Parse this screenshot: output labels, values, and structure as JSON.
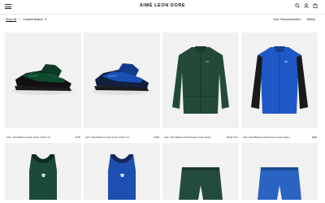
{
  "header": {
    "brand": "AIMÉ LEON DORE"
  },
  "filters": {
    "shop_all": "Shop All",
    "collection": "Curated Basics",
    "sort": "Sort: Recommended",
    "refine": "Refine"
  },
  "products": [
    {
      "name": "ALD / New Balance Fresh Foam X More v5",
      "price": "$175",
      "colors": {
        "main": "#0f4a2f",
        "accent": "#111111"
      }
    },
    {
      "name": "ALD / New Balance Fresh Foam X More v5",
      "price": "$185",
      "colors": {
        "main": "#1a4fb5",
        "accent": "#121f3d"
      }
    },
    {
      "name": "ALD / New Balance Performance Track Jacket",
      "price": "SOLD OUT",
      "colors": {
        "main": "#234a38",
        "accent": "#1c3a2c"
      }
    },
    {
      "name": "ALD / New Balance Performance Track Jacket",
      "price": "$385",
      "colors": {
        "main": "#1f58c7",
        "accent": "#1a1a1a"
      }
    },
    {
      "name": "",
      "price": "",
      "colors": {
        "main": "#1b4a38",
        "accent": "#0e2b20"
      }
    },
    {
      "name": "",
      "price": "",
      "colors": {
        "main": "#1d4fb0",
        "accent": "#13285e"
      }
    },
    {
      "name": "",
      "price": "",
      "colors": {
        "main": "#234b3b",
        "accent": "#1a3a2d"
      }
    },
    {
      "name": "",
      "price": "",
      "colors": {
        "main": "#2a63c4",
        "accent": "#1e4a95"
      }
    }
  ]
}
